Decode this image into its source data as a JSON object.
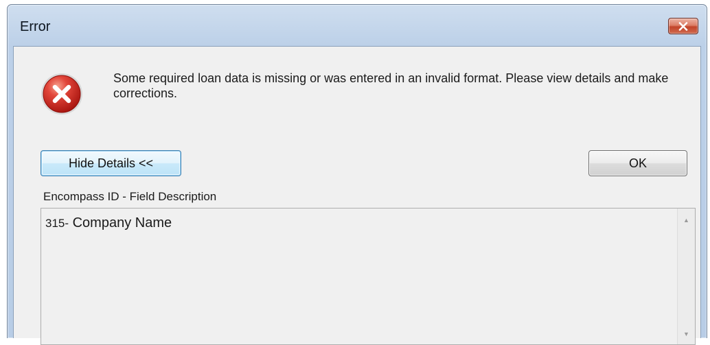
{
  "window": {
    "title": "Error",
    "close_glyph": "✕"
  },
  "dialog": {
    "icon": "error-icon",
    "message": "Some required loan data is missing or was entered in an invalid format. Please view details and make corrections.",
    "hide_details_label": "Hide Details <<",
    "ok_label": "OK"
  },
  "details": {
    "header": "Encompass ID - Field Description",
    "items": [
      {
        "field_id": "315",
        "separator": "-",
        "description": "Company Name"
      }
    ],
    "scroll_up_glyph": "▲",
    "scroll_down_glyph": "▼"
  },
  "colors": {
    "error_red": "#d9241c",
    "close_button_red": "#c2442a",
    "title_bar": "#bcd0e8"
  }
}
